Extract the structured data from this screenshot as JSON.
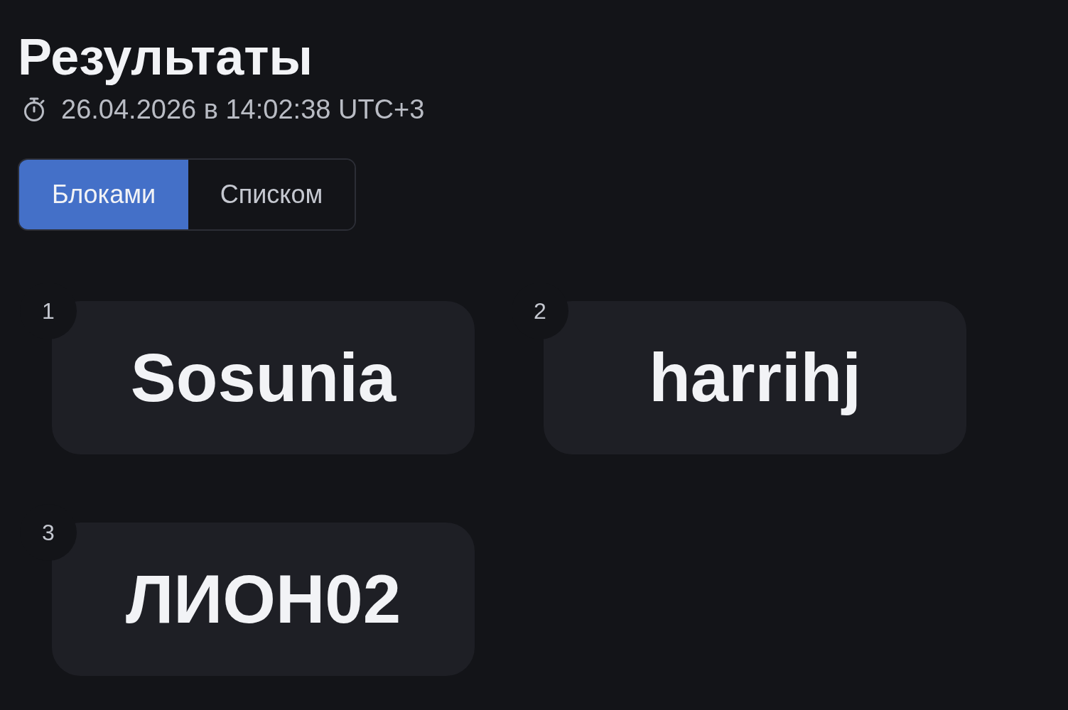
{
  "title": "Результаты",
  "timestamp": "26.04.2026 в 14:02:38 UTC+3",
  "view_toggle": {
    "options": [
      {
        "label": "Блоками",
        "selected": true
      },
      {
        "label": "Списком",
        "selected": false
      }
    ]
  },
  "results": [
    {
      "rank": "1",
      "name": "Sosunia"
    },
    {
      "rank": "2",
      "name": "harrihj"
    },
    {
      "rank": "3",
      "name": "ЛИОН02"
    }
  ]
}
